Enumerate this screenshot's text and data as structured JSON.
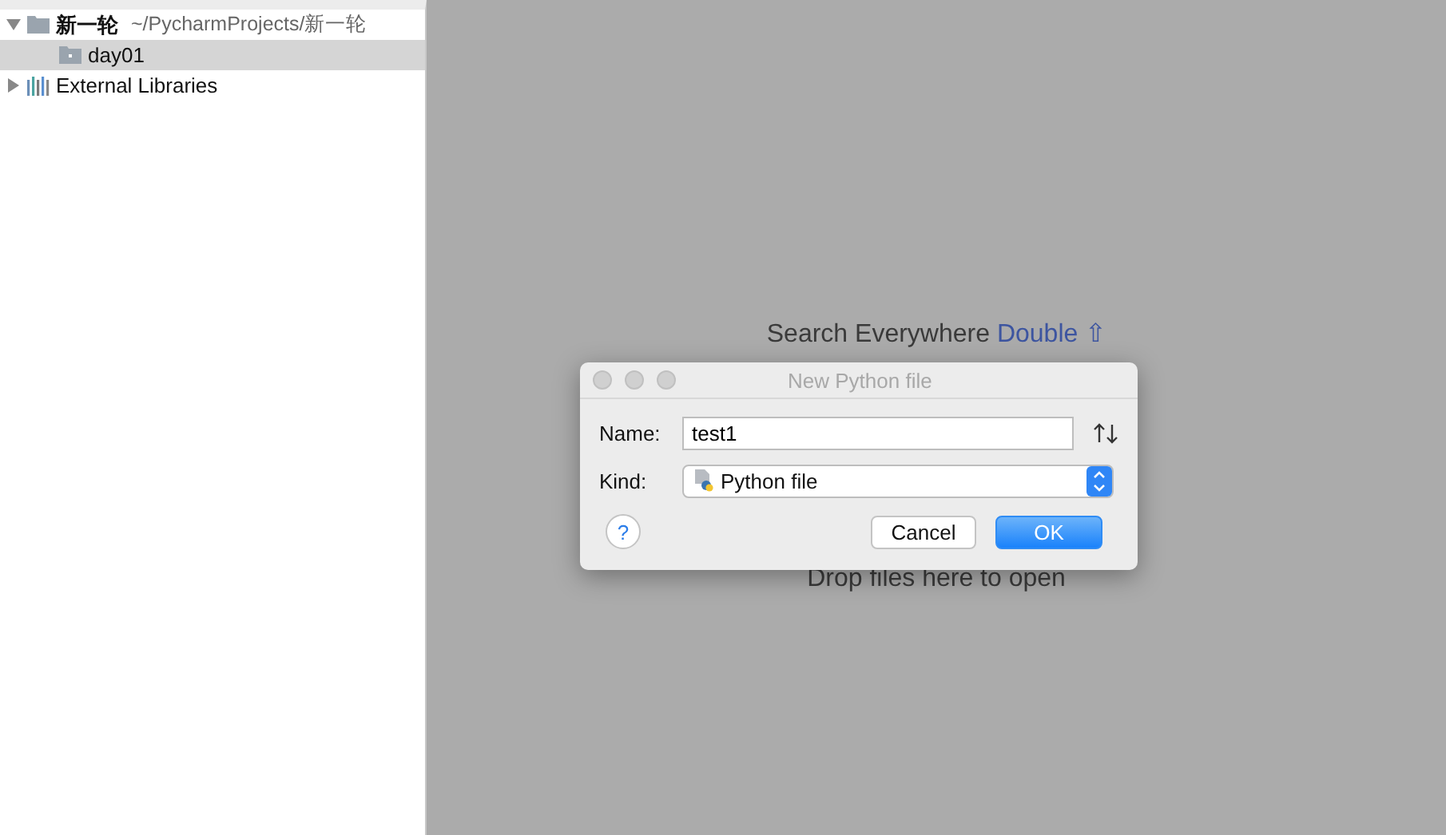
{
  "project_tree": [
    {
      "label": "新一轮",
      "path": "~/PycharmProjects/新一轮",
      "kind": "project",
      "expanded": true,
      "selected": false,
      "children": [
        {
          "label": "day01",
          "kind": "folder",
          "selected": true
        }
      ]
    },
    {
      "label": "External Libraries",
      "kind": "libraries",
      "expanded": false,
      "selected": false
    }
  ],
  "editor_hints": {
    "search": {
      "text": "Search Everywhere",
      "shortcut": "Double ⇧"
    },
    "drop": "Drop files here to open"
  },
  "dialog": {
    "title": "New Python file",
    "fields": [
      {
        "kind": "text",
        "label": "Name:",
        "value": "test1"
      },
      {
        "kind": "select",
        "label": "Kind:",
        "value": "Python file"
      }
    ],
    "help": "?",
    "buttons": [
      {
        "label": "Cancel",
        "default": false
      },
      {
        "label": "OK",
        "default": true
      }
    ]
  }
}
